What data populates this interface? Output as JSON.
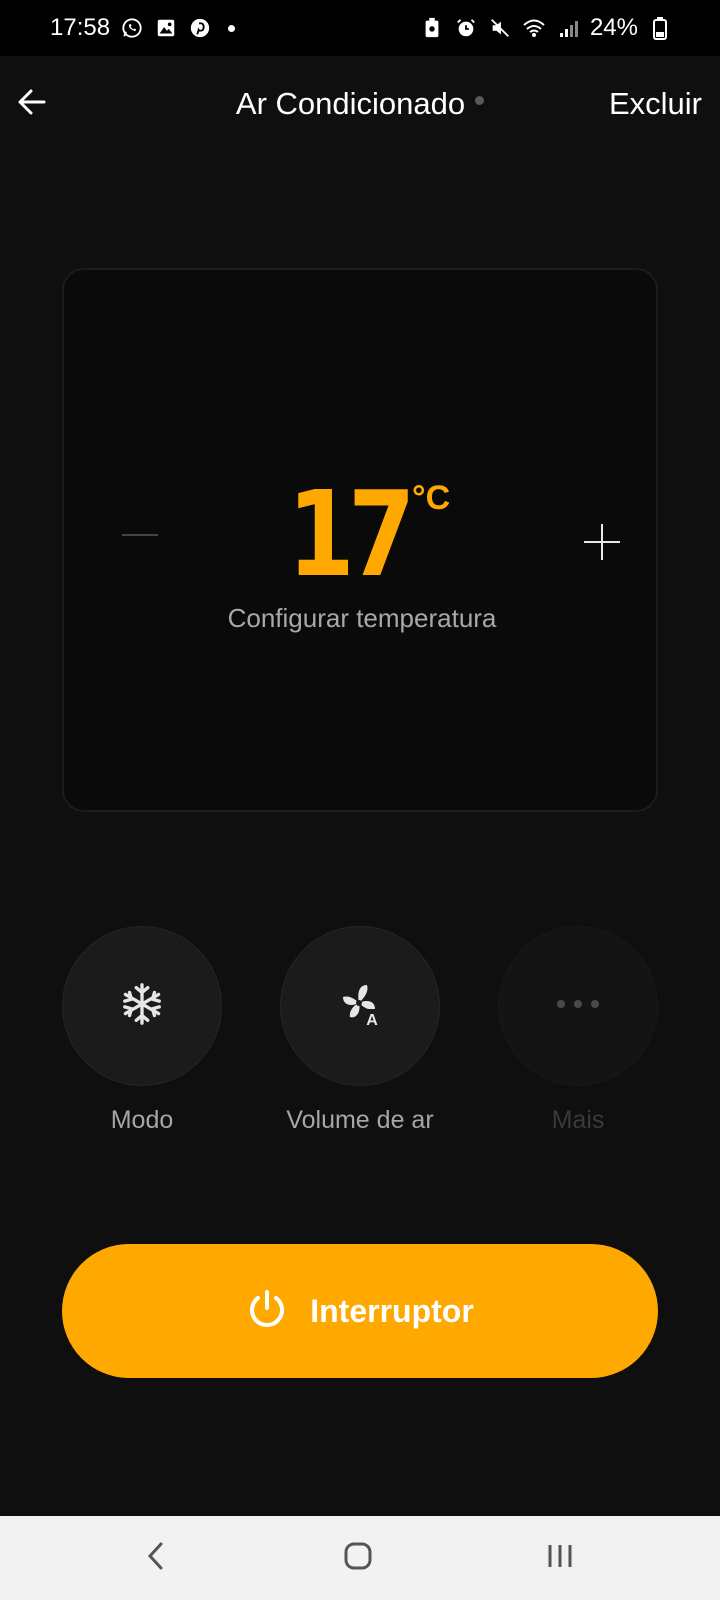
{
  "status_bar": {
    "time": "17:58",
    "battery": "24%",
    "icons_left": [
      "whatsapp-icon",
      "gallery-icon",
      "pinterest-icon",
      "notification-dot"
    ],
    "icons_right": [
      "battery-saver-icon",
      "alarm-icon",
      "mute-icon",
      "wifi-icon",
      "signal-icon",
      "battery-icon"
    ]
  },
  "header": {
    "title": "Ar Condicionado",
    "delete_label": "Excluir",
    "back_icon": "arrow-left-icon"
  },
  "thermostat": {
    "temperature": "17",
    "unit": "°C",
    "label": "Configurar temperatura"
  },
  "controls": [
    {
      "label": "Modo",
      "icon": "snowflake-icon",
      "enabled": true
    },
    {
      "label": "Volume de ar",
      "icon": "fan-auto-icon",
      "enabled": true
    },
    {
      "label": "Mais",
      "icon": "more-icon",
      "enabled": false
    }
  ],
  "power": {
    "label": "Interruptor",
    "icon": "power-icon"
  },
  "colors": {
    "accent": "#ffa800",
    "background": "#0f0f0f"
  }
}
